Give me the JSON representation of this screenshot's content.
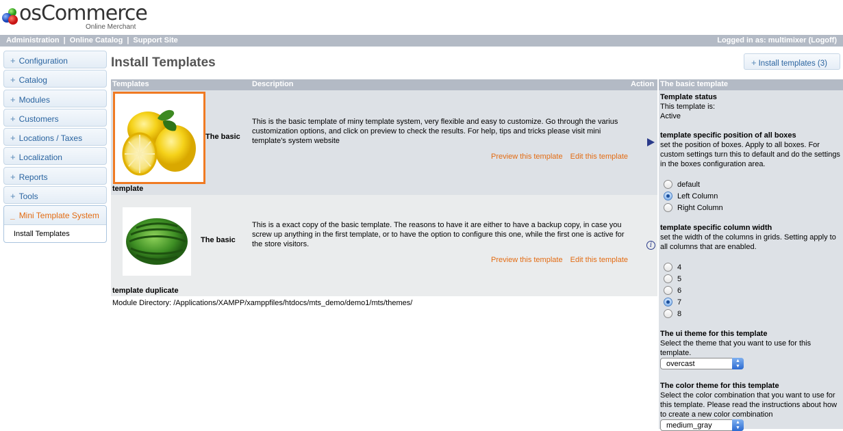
{
  "logo": {
    "name": "osCommerce",
    "tagline": "Online Merchant"
  },
  "topbar": {
    "links": [
      "Administration",
      "Online Catalog",
      "Support Site"
    ],
    "separator": "|",
    "logged_in_prefix": "Logged in as: multimixer",
    "logoff": "(Logoff)"
  },
  "sidebar": {
    "items": [
      {
        "label": "Configuration"
      },
      {
        "label": "Catalog"
      },
      {
        "label": "Modules"
      },
      {
        "label": "Customers"
      },
      {
        "label": "Locations / Taxes"
      },
      {
        "label": "Localization"
      },
      {
        "label": "Reports"
      },
      {
        "label": "Tools"
      }
    ],
    "open_section": {
      "label": "Mini Template System",
      "sub_items": [
        "Install Templates"
      ]
    }
  },
  "page": {
    "title": "Install Templates",
    "install_button": "Install templates (3)"
  },
  "table": {
    "headers": {
      "templates": "Templates",
      "description": "Description",
      "action": "Action"
    },
    "rows": [
      {
        "name": "The basic",
        "name_wrap": "template",
        "description": "This is the basic template of miny template system, very flexible and easy to customize. Go through the varius customization options, and click on preview to check the results. For help, tips and tricks please visit mini template's system website",
        "preview": "Preview this template",
        "edit": "Edit this template"
      },
      {
        "name": "The basic",
        "name_wrap": "template duplicate",
        "description": "This is a exact copy of the basic template. The reasons to have it are either to have a backup copy, in case you screw up anything in the first template, or to have the option to configure this one, while the first one is active for the store visitors.",
        "preview": "Preview this template",
        "edit": "Edit this template"
      }
    ],
    "module_directory": "Module Directory: /Applications/XAMPP/xamppfiles/htdocs/mts_demo/demo1/mts/themes/"
  },
  "panel": {
    "header": "The basic template",
    "status_title": "Template status",
    "status_text": "This template is:",
    "status_value": "Active",
    "position_title": "template specific position of all boxes",
    "position_desc": "set the position of boxes. Apply to all boxes. For custom settings turn this to default and do the settings in the boxes configuration area.",
    "position_options": [
      "default",
      "Left Column",
      "Right Column"
    ],
    "position_selected": "Left Column",
    "width_title": "template specific column width",
    "width_desc": "set the width of the columns in grids. Setting apply to all columns that are enabled.",
    "width_options": [
      "4",
      "5",
      "6",
      "7",
      "8"
    ],
    "width_selected": "7",
    "ui_title": "The ui theme for this template",
    "ui_desc": "Select the theme that you want to use for this template.",
    "ui_value": "overcast",
    "color_title": "The color theme for this template",
    "color_desc": "Select the color combination that you want to use for this template. Please read the instructions about how to create a new color combination",
    "color_value": "medium_gray"
  }
}
